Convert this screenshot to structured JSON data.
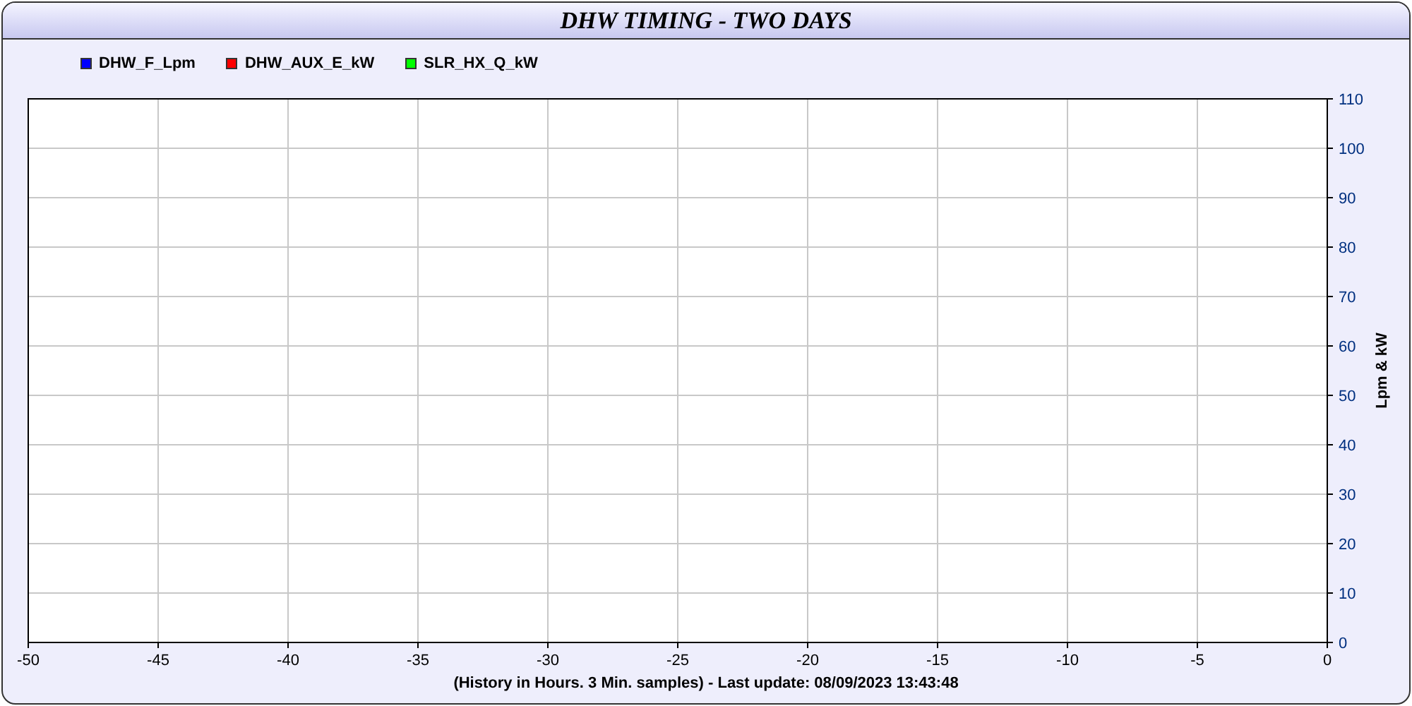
{
  "window": {
    "title": "DHW TIMING - TWO DAYS"
  },
  "chart": {
    "chart_data": {
      "type": "line",
      "xlabel": "(History in Hours. 3 Min. samples) - Last update: 08/09/2023 13:43:48",
      "ylabel": "Lpm & kW",
      "series": [
        {
          "name": "DHW_F_Lpm",
          "color": "#0000ff",
          "values": [
            null,
            null,
            null,
            null,
            null,
            null,
            null,
            null,
            null,
            null,
            null
          ]
        },
        {
          "name": "DHW_AUX_E_kW",
          "color": "#ff0000",
          "values": [
            null,
            null,
            null,
            null,
            null,
            null,
            null,
            null,
            null,
            null,
            null
          ]
        },
        {
          "name": "SLR_HX_Q_kW",
          "color": "#00ff00",
          "values": [
            null,
            null,
            null,
            null,
            null,
            null,
            null,
            null,
            null,
            null,
            null
          ]
        }
      ],
      "categories": [
        "-50",
        "-45",
        "-40",
        "-35",
        "-30",
        "-25",
        "-20",
        "-15",
        "-10",
        "-5",
        "0"
      ],
      "ylim": [
        0,
        110
      ],
      "grid": true,
      "yticks": [
        0,
        10,
        20,
        30,
        40,
        50,
        60,
        70,
        80,
        90,
        100,
        110
      ]
    }
  }
}
